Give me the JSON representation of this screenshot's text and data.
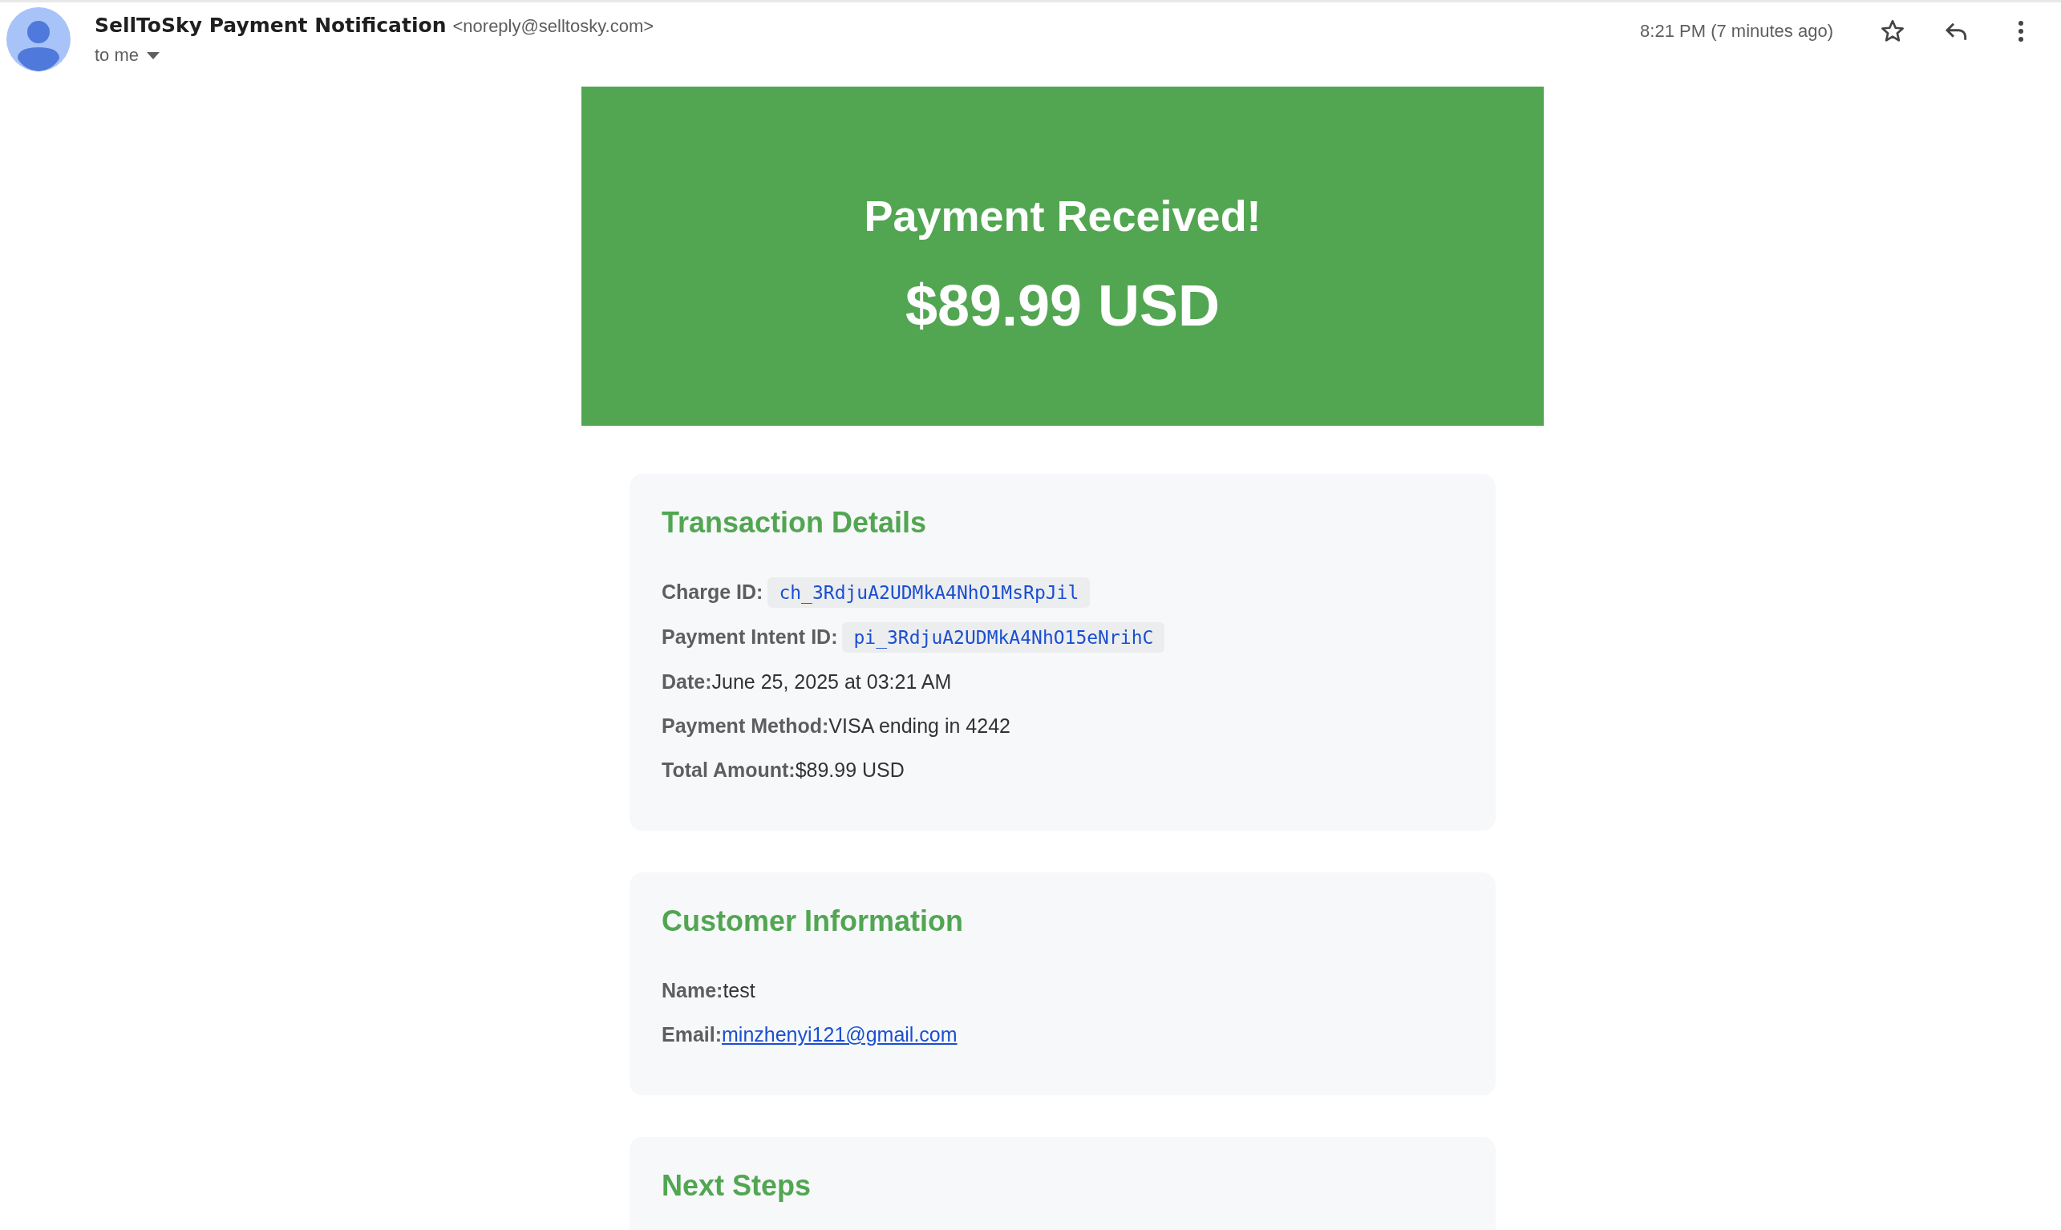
{
  "header": {
    "sender_name": "SellToSky Payment Notification",
    "sender_email": "<noreply@selltosky.com>",
    "recipient": "to me",
    "time": "8:21 PM (7 minutes ago)"
  },
  "banner": {
    "title": "Payment Received!",
    "amount": "$89.99 USD"
  },
  "sections": [
    {
      "heading": "Transaction Details",
      "fields": [
        {
          "label": "Charge ID:",
          "value": "ch_3RdjuA2UDMkA4NhO1MsRpJil",
          "kind": "code"
        },
        {
          "label": "Payment Intent ID:",
          "value": "pi_3RdjuA2UDMkA4NhO15eNrihC",
          "kind": "code"
        },
        {
          "label": "Date:",
          "value": "June 25, 2025 at 03:21 AM",
          "kind": "text"
        },
        {
          "label": "Payment Method:",
          "value": "VISA ending in 4242",
          "kind": "text"
        },
        {
          "label": "Total Amount:",
          "value": "$89.99 USD",
          "kind": "text"
        }
      ]
    },
    {
      "heading": "Customer Information",
      "fields": [
        {
          "label": "Name:",
          "value": "test",
          "kind": "text"
        },
        {
          "label": "Email:",
          "value": "minzhenyi121@gmail.com",
          "kind": "link"
        }
      ]
    },
    {
      "heading": "Next Steps"
    }
  ]
}
